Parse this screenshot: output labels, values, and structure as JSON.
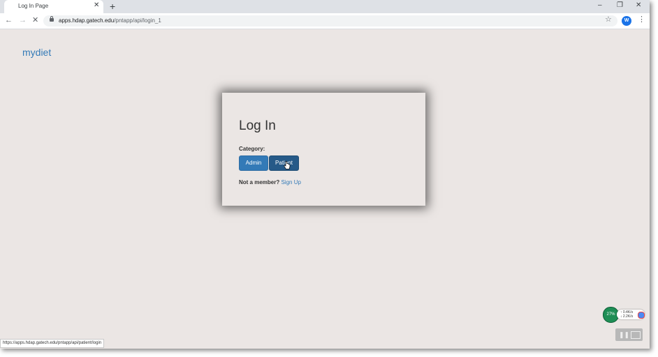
{
  "browser": {
    "tab_title": "Log In Page",
    "tab_close": "✕",
    "new_tab": "+",
    "window_controls": {
      "minimize": "–",
      "restore": "❐",
      "close": "✕"
    },
    "nav": {
      "back": "←",
      "forward": "→",
      "stop": "✕"
    },
    "url_host": "apps.hdap.gatech.edu",
    "url_path": "/pntapp/api/login_1",
    "bookmark_icon": "☆",
    "profile_initial": "W",
    "menu_icon": "⋮",
    "status_url": "https://apps.hdap.gatech.edu/pntapp/api/patient/login"
  },
  "page": {
    "brand": "mydiet",
    "login": {
      "title": "Log In",
      "category_label": "Category:",
      "admin_button": "Admin",
      "patient_button": "Patient",
      "not_member": "Not a member?",
      "sign_up": "Sign Up"
    }
  },
  "overlay": {
    "cpu_percent": "27%",
    "upload": "↑ 0.4K/s",
    "download": "↓ 2.2K/s",
    "pause_icon": "❚❚"
  },
  "colors": {
    "page_bg": "#ebe6e4",
    "link": "#337ab7",
    "admin_btn": "#337ab7",
    "patient_btn": "#265a88"
  }
}
